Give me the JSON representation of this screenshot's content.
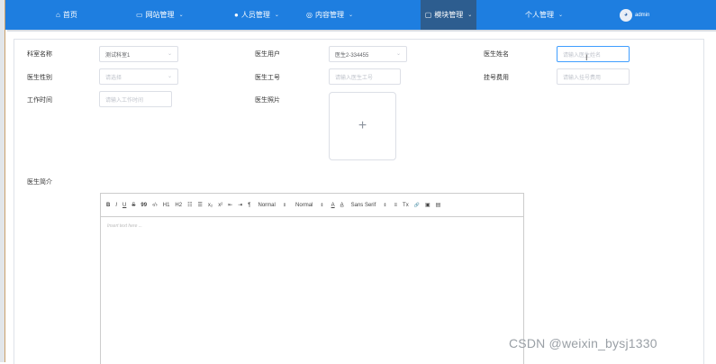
{
  "nav": {
    "items": [
      {
        "label": "首页",
        "icon": "home-icon"
      },
      {
        "label": "网站管理",
        "icon": "monitor-icon"
      },
      {
        "label": "人员管理",
        "icon": "user-icon"
      },
      {
        "label": "内容管理",
        "icon": "chat-icon"
      },
      {
        "label": "模块管理",
        "icon": "tablet-icon"
      },
      {
        "label": "个人管理",
        "icon": ""
      }
    ],
    "user_name": "admin",
    "active_color": "#2d5d8f",
    "bar_color": "#1e7ee0"
  },
  "form": {
    "dept_label": "科室名称",
    "dept_value": "测试科室1",
    "doctor_user_label": "医生用户",
    "doctor_user_value": "医生2-334455",
    "doctor_name_label": "医生姓名",
    "doctor_name_placeholder": "请输入医生姓名",
    "gender_label": "医生性别",
    "gender_placeholder": "请选择",
    "doctor_no_label": "医生工号",
    "doctor_no_placeholder": "请输入医生工号",
    "fee_label": "挂号费用",
    "fee_placeholder": "请输入挂号费用",
    "worktime_label": "工作时间",
    "worktime_placeholder": "请输入工作时间",
    "photo_label": "医生照片",
    "upload_symbol": "+",
    "intro_label": "医生简介"
  },
  "editor": {
    "placeholder": "Insert text here ...",
    "toolbar": {
      "bold": "B",
      "italic": "I",
      "underline": "U",
      "strike": "S",
      "blockquote": "99",
      "code": "‹/›",
      "h1": "H1",
      "h2": "H2",
      "ordered_list": "☷",
      "bullet_list": "☰",
      "subscript": "x₂",
      "superscript": "x²",
      "outdent": "⇤",
      "indent": "⇥",
      "direction": "¶",
      "size": "Normal",
      "header": "Normal",
      "color": "A",
      "background": "A̲",
      "font": "Sans Serif",
      "align": "≡",
      "clean": "Tx",
      "link": "🔗",
      "image": "▣",
      "video": "▤"
    }
  },
  "watermark": "CSDN @weixin_bysj1330"
}
